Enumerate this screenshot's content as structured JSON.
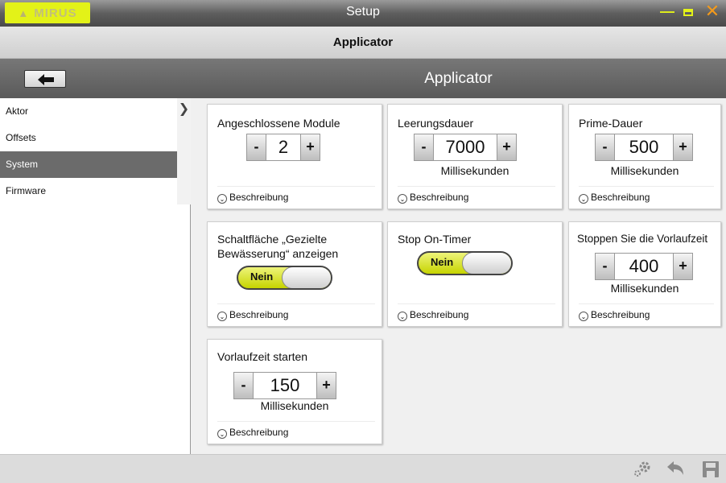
{
  "app": {
    "logo_text": "MIRUS",
    "window_title": "Setup",
    "subheader": "Applicator",
    "section_title": "Applicator"
  },
  "window_controls": [
    "minimize-icon",
    "maximize-icon",
    "close-icon"
  ],
  "colors": {
    "accent": "#e3f218",
    "close": "#f39a1b",
    "dark_bar": "#5e5e5e",
    "selected": "#6b6b6b"
  },
  "sidebar": {
    "items": [
      {
        "label": "Aktor"
      },
      {
        "label": "Offsets"
      },
      {
        "label": "System",
        "selected": true
      },
      {
        "label": "Firmware"
      }
    ]
  },
  "cards": {
    "modules": {
      "title": "Angeschlossene Module",
      "value": "2",
      "desc": "Beschreibung"
    },
    "drain": {
      "title": "Leerungsdauer",
      "value": "7000",
      "units": "Millisekunden",
      "desc": "Beschreibung"
    },
    "prime": {
      "title": "Prime-Dauer",
      "value": "500",
      "units": "Millisekunden",
      "desc": "Beschreibung"
    },
    "targeted": {
      "title": "Schaltfläche „Gezielte Bewässerung“ anzeigen",
      "toggle": "Nein",
      "desc": "Beschreibung"
    },
    "stop_timer": {
      "title": "Stop On-Timer",
      "toggle": "Nein",
      "desc": "Beschreibung"
    },
    "stop_lead": {
      "title": "Stoppen Sie die Vorlaufzeit",
      "value": "400",
      "units": "Millisekunden",
      "desc": "Beschreibung"
    },
    "start_lead": {
      "title": "Vorlaufzeit starten",
      "value": "150",
      "units": "Millisekunden",
      "desc": "Beschreibung"
    }
  },
  "stepper": {
    "minus": "-",
    "plus": "+"
  },
  "footer_icons": [
    "settings-icon",
    "undo-icon",
    "save-icon"
  ]
}
